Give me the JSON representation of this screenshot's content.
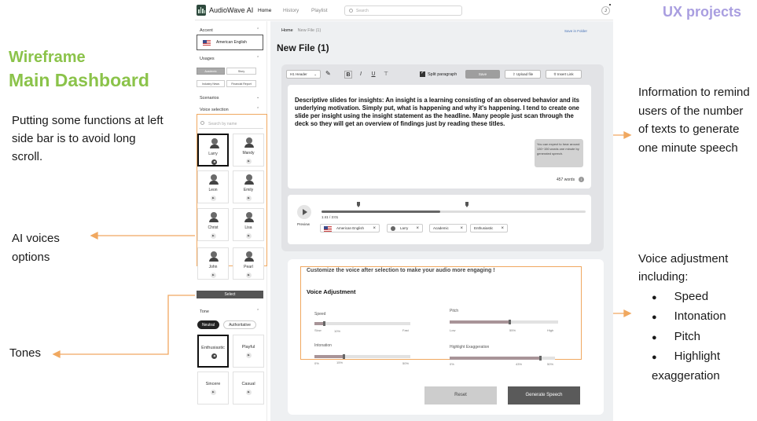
{
  "annotations": {
    "ux_projects": "UX projects",
    "wireframe": "Wireframe",
    "main_dashboard": "Main Dashboard",
    "sidebar_note": "Putting some functions at left side bar is to avoid long scroll.",
    "ai_voices": "AI voices options",
    "tones": "Tones",
    "info_note": "Information to remind users of the number of texts to generate one minute speech",
    "voice_adj_title": "Voice adjustment including:",
    "voice_adj_items": [
      "Speed",
      "Intonation",
      "Pitch",
      "Highlight exaggeration"
    ]
  },
  "header": {
    "brand": "AudioWave AI",
    "nav": [
      "Home",
      "History",
      "Playlist"
    ],
    "search_placeholder": "Search",
    "avatar_initial": "J"
  },
  "sidebar": {
    "accent_label": "Accent",
    "accent_value": "American English",
    "usages_label": "Usages",
    "usages": [
      "Academic",
      "Story",
      "Industry News",
      "Financial Report"
    ],
    "scenarios_label": "Scenarios",
    "voice_selection_label": "Voice selection",
    "voice_search_placeholder": "Search by name",
    "voices": [
      "Larry",
      "Mandy",
      "Leon",
      "Emily",
      "Christ",
      "Lisa",
      "John",
      "Pearl"
    ],
    "select_label": "Select",
    "tone_label": "Tone",
    "tone_pills": [
      "Neutral",
      "Authoritative"
    ],
    "tone_cards": [
      "Enthusiastic",
      "Playful",
      "Sincere",
      "Casual"
    ]
  },
  "main": {
    "breadcrumb_home": "Home",
    "breadcrumb_current": "New File (1)",
    "save_in_folder": "Save in Folder",
    "title": "New File (1)",
    "toolbar": {
      "header_select": "H1 Header",
      "split_paragraph": "Split paragraph",
      "save": "Save",
      "upload": "Upload file",
      "insert_link": "Insert Link"
    },
    "body_text": "Descriptive slides for insights: An insight is a learning consisting of an observed behavior and its underlying motivation. Simply put, what is happening and why it's happening. I tend to create one slide per insight using the insight statement as the headline. Many people just scan through the deck so they will get an overview of findings just by reading these titles.",
    "tooltip": "You can expect to hear around 130~150 words one minute by generated speech.",
    "word_count": "457 words",
    "player": {
      "preview": "Preview",
      "time": "1:41 / 3:01",
      "progress": 0.45,
      "tags": [
        "American English",
        "Larry",
        "Academic",
        "Enthusiastic"
      ]
    },
    "adjust": {
      "hint": "Customize the voice after selection to make your audio more engaging !",
      "title": "Voice Adjustment",
      "speed": {
        "label": "Speed",
        "ticks": [
          "Slow",
          "10%",
          "Fast"
        ],
        "value": 0.1
      },
      "pitch": {
        "label": "Pitch",
        "ticks": [
          "Low",
          "55%",
          "High"
        ],
        "value": 0.55
      },
      "intonation": {
        "label": "Intonation",
        "ticks": [
          "0%",
          "15%",
          "50%"
        ],
        "value": 0.15
      },
      "highlight": {
        "label": "Highlight Exaggeration",
        "ticks": [
          "0%",
          "43%",
          "50%"
        ],
        "value": 0.43
      },
      "reset": "Reset",
      "generate": "Generate Speech"
    }
  },
  "colors": {
    "annotation_green": "#8bc34a",
    "ux_purple": "#a99ee0",
    "annotation_orange": "#f0a860"
  }
}
